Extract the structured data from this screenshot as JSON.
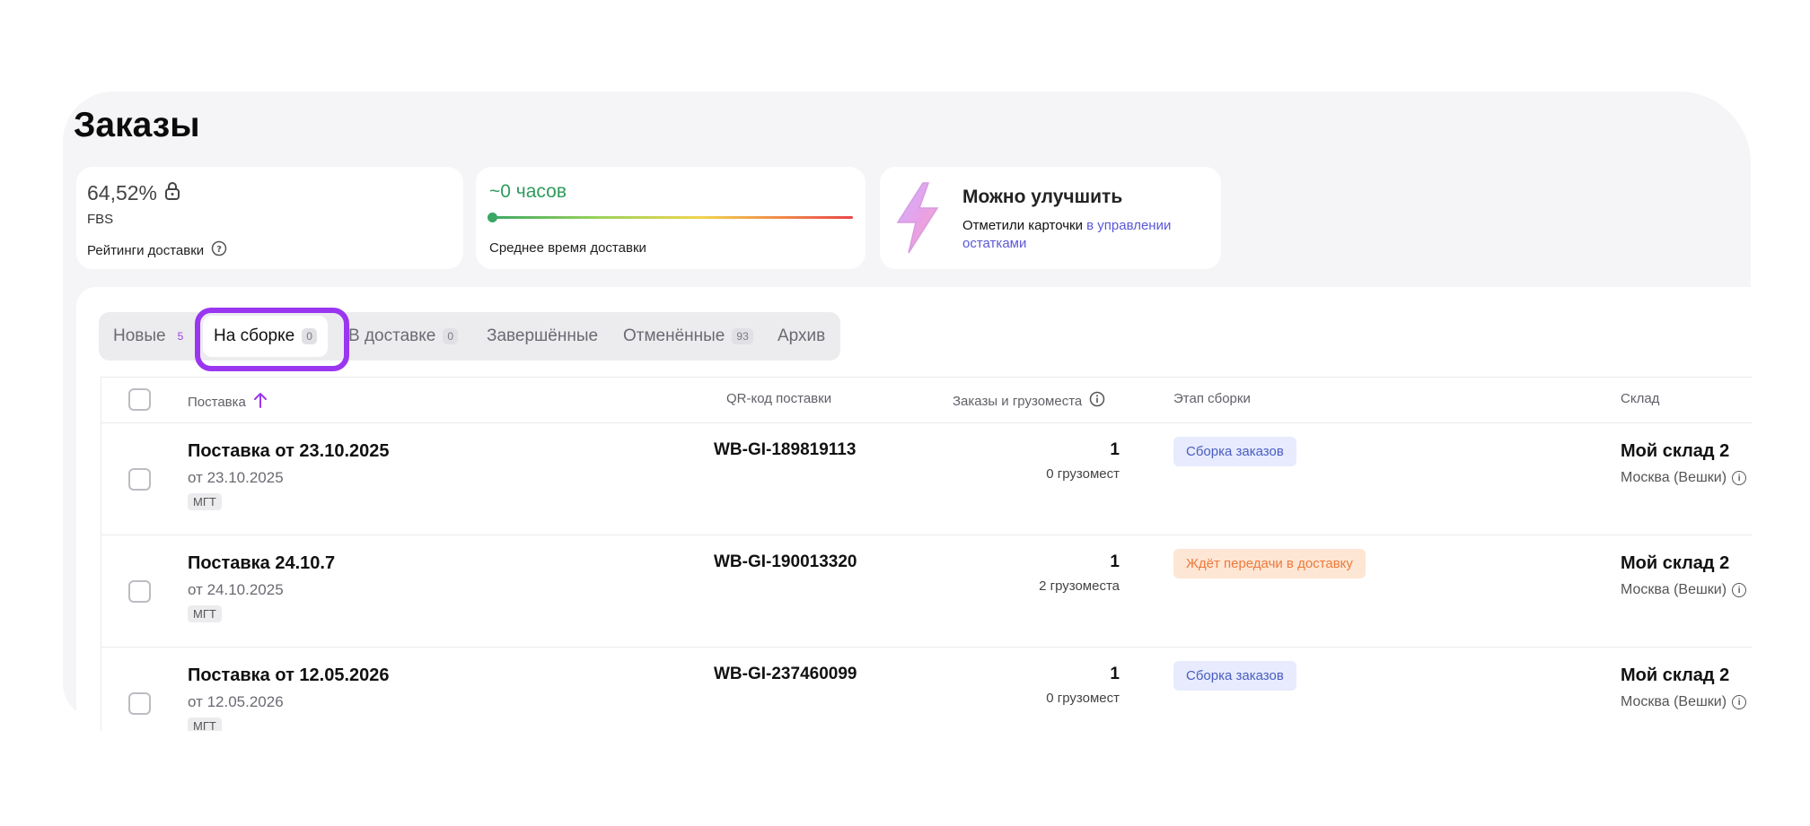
{
  "page": {
    "title": "Заказы"
  },
  "cards": {
    "rating": {
      "percent": "64,52%",
      "scheme": "FBS",
      "label": "Рейтинги доставки"
    },
    "delivery": {
      "hours": "~0 часов",
      "label": "Среднее время доставки"
    },
    "improve": {
      "title": "Можно улучшить",
      "text": "Отметили карточки ",
      "link": "в управлении остатками"
    }
  },
  "tabs": [
    {
      "label": "Новые",
      "count": "5"
    },
    {
      "label": "На сборке",
      "count": "0"
    },
    {
      "label": "В доставке",
      "count": "0"
    },
    {
      "label": "Завершённые",
      "count": ""
    },
    {
      "label": "Отменённые",
      "count": "93"
    },
    {
      "label": "Архив",
      "count": ""
    }
  ],
  "table": {
    "headers": {
      "supply": "Поставка",
      "qr": "QR-код поставки",
      "orders": "Заказы и грузоместа",
      "stage": "Этап сборки",
      "warehouse": "Склад"
    },
    "rows": [
      {
        "title": "Поставка от 23.10.2025",
        "date": "от 23.10.2025",
        "tag": "МГТ",
        "qr": "WB-GI-189819113",
        "orders": "1",
        "places": "0 грузомест",
        "stage": "Сборка заказов",
        "warehouse": "Мой склад 2",
        "city": "Москва (Вешки)"
      },
      {
        "title": "Поставка 24.10.7",
        "date": "от 24.10.2025",
        "tag": "МГТ",
        "qr": "WB-GI-190013320",
        "orders": "1",
        "places": "2 грузоместа",
        "stage": "Ждёт передачи в доставку",
        "warehouse": "Мой склад 2",
        "city": "Москва (Вешки)"
      },
      {
        "title": "Поставка от 12.05.2026",
        "date": "от 12.05.2026",
        "tag": "МГТ",
        "qr": "WB-GI-237460099",
        "orders": "1",
        "places": "0 грузомест",
        "stage": "Сборка заказов",
        "warehouse": "Мой склад 2",
        "city": "Москва (Вешки)"
      }
    ]
  },
  "colors": {
    "highlight": "#9a36f0",
    "accent_green": "#2e9b5e",
    "link": "#5b59d8"
  }
}
